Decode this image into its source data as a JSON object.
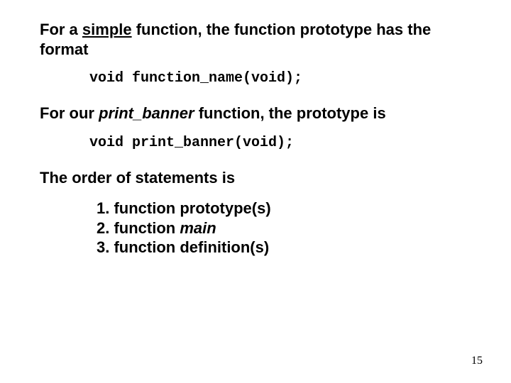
{
  "p1": {
    "pre": "For a ",
    "simple": "simple",
    "post": " function, the function prototype has the format"
  },
  "code1": "void function_name(void);",
  "p2": {
    "pre": "For our ",
    "fn": "print_banner",
    "post": " function, the prototype is"
  },
  "code2": "void print_banner(void);",
  "p3": "The order of statements is",
  "list": {
    "item1": "1. function prototype(s)",
    "item2_pre": "2. function ",
    "item2_main": "main",
    "item3": "3. function definition(s)"
  },
  "page_number": "15"
}
